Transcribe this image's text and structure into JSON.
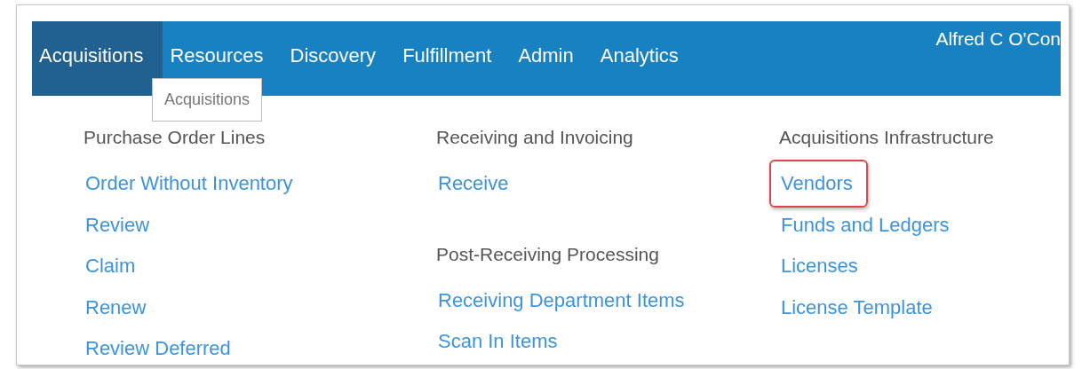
{
  "nav_tabs": [
    {
      "label": "Acquisitions",
      "selected": true
    },
    {
      "label": "Resources",
      "selected": false
    },
    {
      "label": "Discovery",
      "selected": false
    },
    {
      "label": "Fulfillment",
      "selected": false
    },
    {
      "label": "Admin",
      "selected": false
    },
    {
      "label": "Analytics",
      "selected": false
    }
  ],
  "user_name": "Alfred C O'Con",
  "tooltip": "Acquisitions",
  "menu_columns": [
    {
      "sections": [
        {
          "heading": "Purchase Order Lines",
          "links": [
            {
              "label": "Order Without Inventory",
              "highlighted": false
            },
            {
              "label": "Review",
              "highlighted": false
            },
            {
              "label": "Claim",
              "highlighted": false
            },
            {
              "label": "Renew",
              "highlighted": false
            },
            {
              "label": "Review Deferred",
              "highlighted": false
            }
          ]
        }
      ]
    },
    {
      "sections": [
        {
          "heading": "Receiving and Invoicing",
          "links": [
            {
              "label": "Receive",
              "highlighted": false
            }
          ]
        },
        {
          "heading": "Post-Receiving Processing",
          "links": [
            {
              "label": "Receiving Department Items",
              "highlighted": false
            },
            {
              "label": "Scan In Items",
              "highlighted": false
            }
          ]
        }
      ]
    },
    {
      "sections": [
        {
          "heading": "Acquisitions Infrastructure",
          "links": [
            {
              "label": "Vendors",
              "highlighted": true
            },
            {
              "label": "Funds and Ledgers",
              "highlighted": false
            },
            {
              "label": "Licenses",
              "highlighted": false
            },
            {
              "label": "License Template",
              "highlighted": false
            }
          ]
        }
      ]
    }
  ]
}
